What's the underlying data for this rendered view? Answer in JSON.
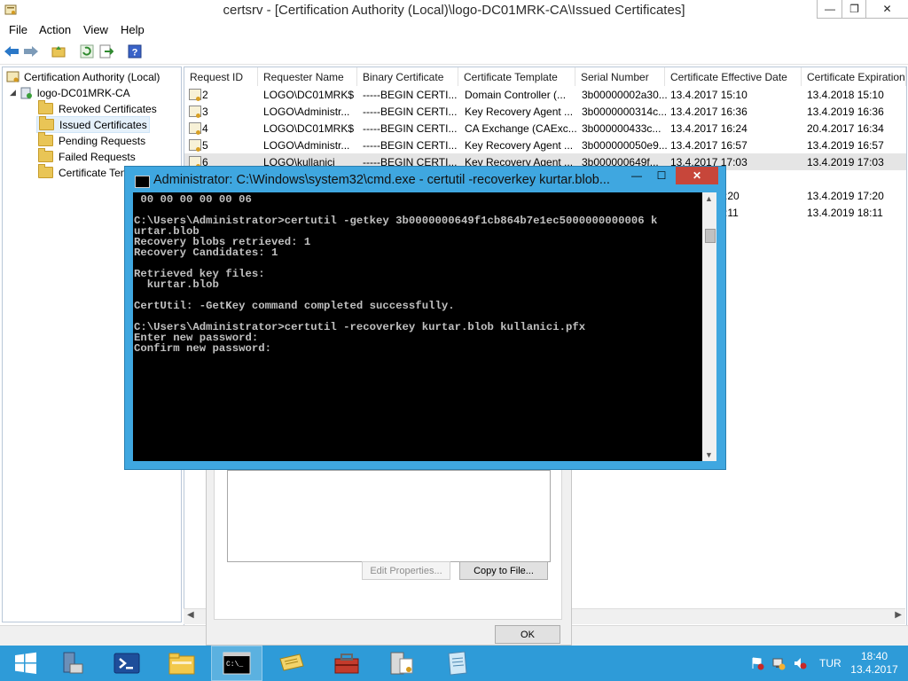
{
  "window": {
    "title": "certsrv - [Certification Authority (Local)\\logo-DC01MRK-CA\\Issued Certificates]",
    "min_label": "—",
    "max_label": "❐",
    "close_label": "✕"
  },
  "menu": {
    "file": "File",
    "action": "Action",
    "view": "View",
    "help": "Help"
  },
  "tree": {
    "root": "Certification Authority (Local)",
    "ca": "logo-DC01MRK-CA",
    "items": [
      "Revoked Certificates",
      "Issued Certificates",
      "Pending Requests",
      "Failed Requests",
      "Certificate Ten"
    ]
  },
  "table": {
    "columns": [
      "Request ID",
      "Requester Name",
      "Binary Certificate",
      "Certificate Template",
      "Serial Number",
      "Certificate Effective Date",
      "Certificate Expiration"
    ],
    "rows": [
      [
        "2",
        "LOGO\\DC01MRK$",
        "-----BEGIN CERTI...",
        "Domain Controller (...",
        "3b00000002a30...",
        "13.4.2017 15:10",
        "13.4.2018 15:10"
      ],
      [
        "3",
        "LOGO\\Administr...",
        "-----BEGIN CERTI...",
        "Key Recovery Agent ...",
        "3b0000000314c...",
        "13.4.2017 16:36",
        "13.4.2019 16:36"
      ],
      [
        "4",
        "LOGO\\DC01MRK$",
        "-----BEGIN CERTI...",
        "CA Exchange (CAExc...",
        "3b000000433c...",
        "13.4.2017 16:24",
        "20.4.2017 16:34"
      ],
      [
        "5",
        "LOGO\\Administr...",
        "-----BEGIN CERTI...",
        "Key Recovery Agent ...",
        "3b000000050e9...",
        "13.4.2017 16:57",
        "13.4.2019 16:57"
      ],
      [
        "6",
        "LOGO\\kullanici",
        "-----BEGIN CERTI...",
        "Key Recovery Agent ...",
        "3b000000649f...",
        "13.4.2017 17:03",
        "13.4.2019 17:03"
      ]
    ],
    "extra_rows": [
      [
        "",
        "",
        "",
        "",
        "",
        ":20",
        "13.4.2019 17:20"
      ],
      [
        "",
        "",
        "",
        "",
        "",
        ":11",
        "13.4.2019 18:11"
      ]
    ]
  },
  "dialog": {
    "edit_properties": "Edit Properties...",
    "copy_to_file": "Copy to File...",
    "ok": "OK"
  },
  "cmd": {
    "title": "Administrator: C:\\Windows\\system32\\cmd.exe - certutil  -recoverkey kurtar.blob...",
    "min_label": "—",
    "max_label": "☐",
    "close_label": "✕",
    "console_text": " 00 00 00 00 00 06\n\nC:\\Users\\Administrator>certutil -getkey 3b0000000649f1cb864b7e1ec5000000000006 k\nurtar.blob\nRecovery blobs retrieved: 1\nRecovery Candidates: 1\n\nRetrieved key files:\n  kurtar.blob\n\nCertUtil: -GetKey command completed successfully.\n\nC:\\Users\\Administrator>certutil -recoverkey kurtar.blob kullanici.pfx\nEnter new password:\nConfirm new password:"
  },
  "taskbar": {
    "language": "TUR",
    "time": "18:40",
    "date": "13.4.2017"
  }
}
